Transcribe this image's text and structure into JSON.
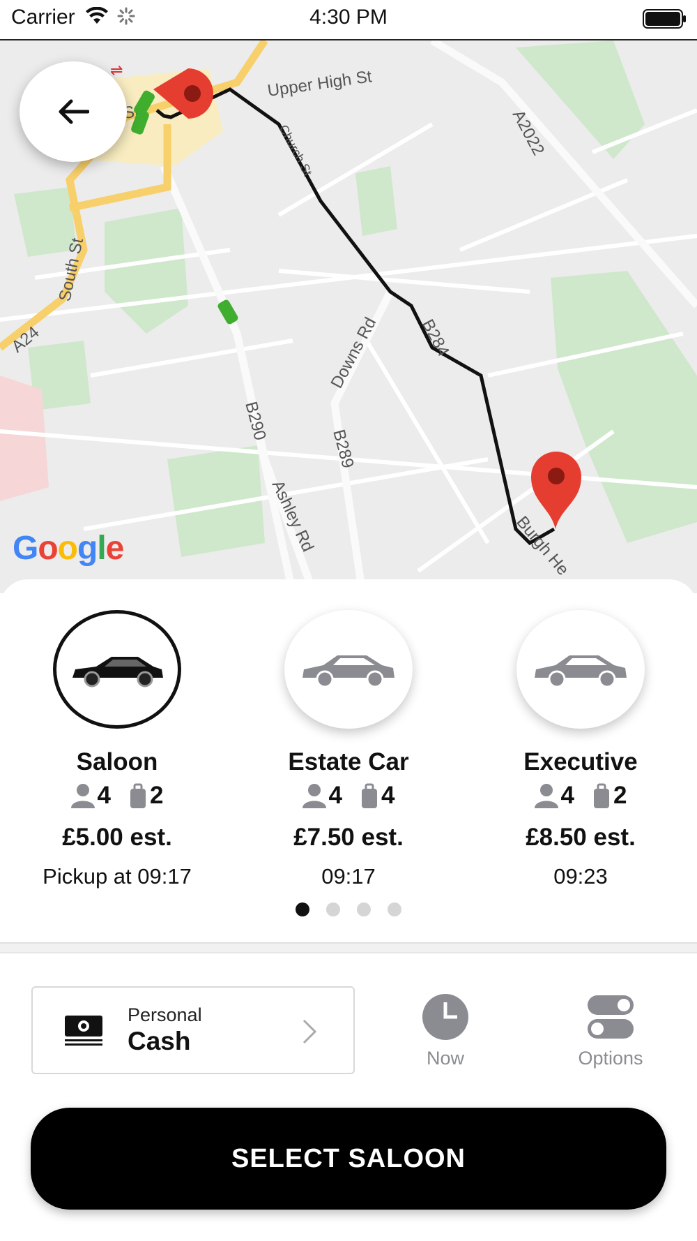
{
  "status_bar": {
    "carrier": "Carrier",
    "time": "4:30 PM"
  },
  "map": {
    "attribution": [
      "G",
      "o",
      "o",
      "g",
      "l",
      "e"
    ],
    "attribution_colors": [
      "#4285F4",
      "#EA4335",
      "#FBBC05",
      "#4285F4",
      "#34A853",
      "#EA4335"
    ],
    "road_labels": [
      "Upper High St",
      "A2022",
      "Church St",
      "South St",
      "A24",
      "Downs Rd",
      "B284",
      "B290",
      "B289",
      "Ashley Rd",
      "Burgh He",
      "St"
    ],
    "route_color": "#111111",
    "pin_color": "#E53E30"
  },
  "back_button": {
    "icon": "arrow-left-icon"
  },
  "vehicles": [
    {
      "name": "Saloon",
      "passengers": "4",
      "luggage": "2",
      "price": "£5.00 est.",
      "time": "Pickup at 09:17",
      "selected": true,
      "icon": "car-photo-icon"
    },
    {
      "name": "Estate Car",
      "passengers": "4",
      "luggage": "4",
      "price": "£7.50 est.",
      "time": "09:17",
      "selected": false,
      "icon": "car-silhouette-icon"
    },
    {
      "name": "Executive",
      "passengers": "4",
      "luggage": "2",
      "price": "£8.50 est.",
      "time": "09:23",
      "selected": false,
      "icon": "car-silhouette-icon"
    }
  ],
  "pagination": {
    "pages": 4,
    "active": 1
  },
  "payment": {
    "type": "Personal",
    "method": "Cash",
    "icon": "cash-icon"
  },
  "schedule": {
    "label": "Now",
    "icon": "clock-icon"
  },
  "options": {
    "label": "Options",
    "icon": "toggles-icon"
  },
  "select_button": {
    "label": "SELECT SALOON"
  },
  "colors": {
    "accent": "#000000",
    "muted": "#8a8c92",
    "park": "#cfe8cc"
  }
}
